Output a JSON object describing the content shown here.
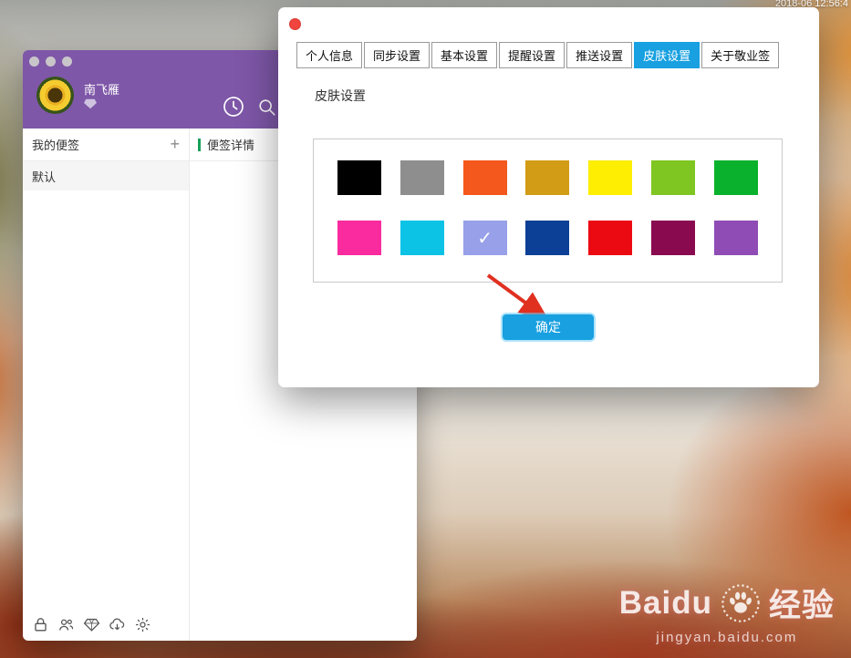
{
  "desktop": {
    "menubar_time": "2018-06 12:56:4"
  },
  "window": {
    "user_name": "南飞雁",
    "header_color": "#7e57a8",
    "detail_accent": "#16a05a",
    "sidebar_title": "我的便签",
    "add_button": "+",
    "note_list": [
      {
        "label": "默认"
      }
    ],
    "detail_title": "便签详情"
  },
  "dialog": {
    "tabs": [
      {
        "label": "个人信息",
        "active": false
      },
      {
        "label": "同步设置",
        "active": false
      },
      {
        "label": "基本设置",
        "active": false
      },
      {
        "label": "提醒设置",
        "active": false
      },
      {
        "label": "推送设置",
        "active": false
      },
      {
        "label": "皮肤设置",
        "active": true
      },
      {
        "label": "关于敬业签",
        "active": false
      }
    ],
    "section_title": "皮肤设置",
    "skin_colors": {
      "row1": [
        "#000000",
        "#8e8e8e",
        "#f4581c",
        "#d39c16",
        "#fdee02",
        "#7fc622",
        "#0ab12c"
      ],
      "row2": [
        "#fa2b9e",
        "#0cc3e6",
        "#97a0e8",
        "#0c3f96",
        "#ec0a12",
        "#8a0a50",
        "#8f4cb5"
      ],
      "selected_row": 2,
      "selected_col": 3,
      "check_glyph": "✓"
    },
    "ok_button": "确定",
    "accent_color": "#18a0e0",
    "arrow_color": "#e03020"
  },
  "watermark": {
    "brand_left": "Baidu",
    "brand_right": "经验",
    "url": "jingyan.baidu.com"
  }
}
